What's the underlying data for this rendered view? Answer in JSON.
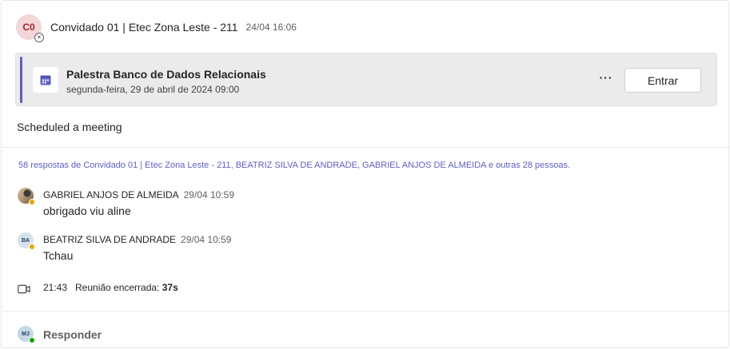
{
  "post": {
    "avatar_initials": "C0",
    "author": "Convidado 01 | Etec Zona Leste - 211",
    "timestamp": "24/04 16:06"
  },
  "meeting": {
    "title": "Palestra Banco de Dados Relacionais",
    "date": "segunda-feira, 29 de abril de 2024 09:00",
    "more_label": "···",
    "join_label": "Entrar"
  },
  "scheduled_text": "Scheduled a meeting",
  "replies_summary": "58 respostas de Convidado 01 | Etec Zona Leste - 211, BEATRIZ SILVA DE ANDRADE, GABRIEL ANJOS DE ALMEIDA e outras 28 pessoas.",
  "replies": [
    {
      "author": "GABRIEL ANJOS DE ALMEIDA",
      "time": "29/04 10:59",
      "text": "obrigado viu aline",
      "status_color": "#eaa300"
    },
    {
      "author": "BEATRIZ SILVA DE ANDRADE",
      "avatar_initials": "BA",
      "time": "29/04 10:59",
      "text": "Tchau",
      "status_color": "#eaa300"
    }
  ],
  "meeting_ended": {
    "icon": "video-camera-icon",
    "time": "21:43",
    "label": "Reunião encerrada:",
    "duration": "37s"
  },
  "reply_bar": {
    "avatar_initials": "MJ",
    "label": "Responder"
  },
  "colors": {
    "accent": "#5b5fc7",
    "link": "#5b5fc7",
    "away": "#eaa300",
    "available": "#13a10e"
  }
}
